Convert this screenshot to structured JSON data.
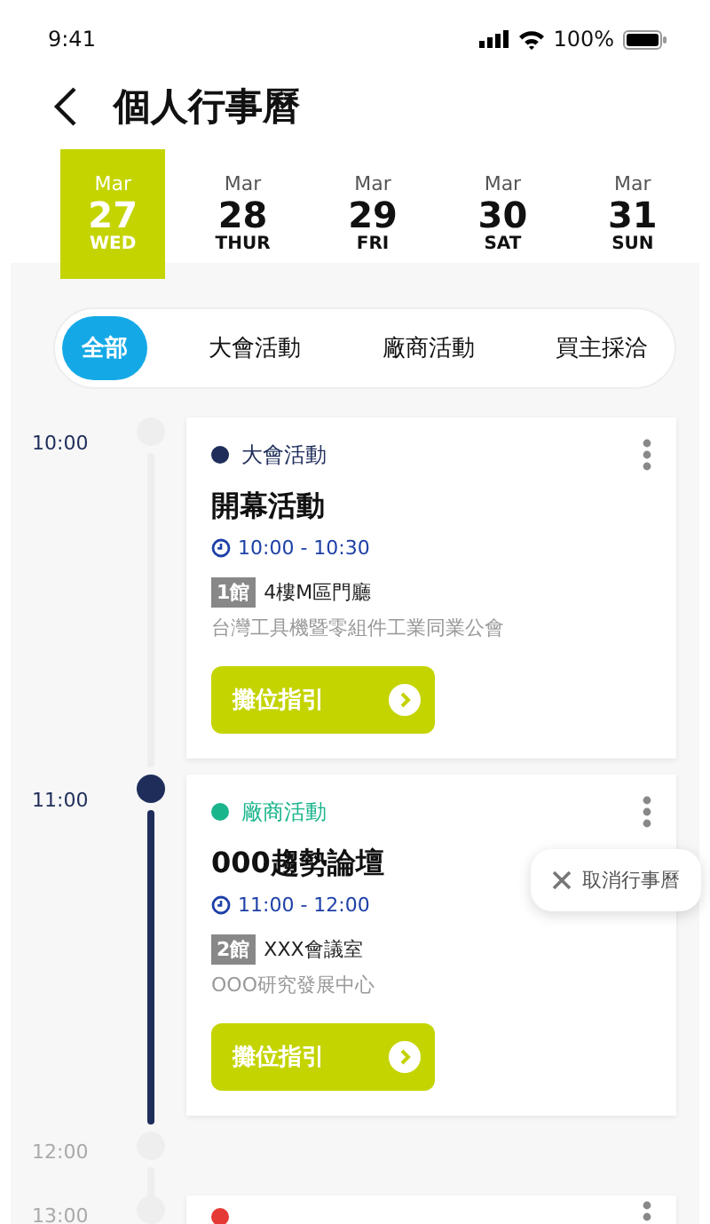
{
  "status_bar": {
    "time": "9:41",
    "battery": "100%"
  },
  "header": {
    "title": "個人行事曆"
  },
  "dates": [
    {
      "month": "Mar",
      "day": "27",
      "weekday": "WED",
      "selected": true
    },
    {
      "month": "Mar",
      "day": "28",
      "weekday": "THUR",
      "selected": false
    },
    {
      "month": "Mar",
      "day": "29",
      "weekday": "FRI",
      "selected": false
    },
    {
      "month": "Mar",
      "day": "30",
      "weekday": "SAT",
      "selected": false
    },
    {
      "month": "Mar",
      "day": "31",
      "weekday": "SUN",
      "selected": false
    }
  ],
  "filters": [
    {
      "label": "全部",
      "selected": true
    },
    {
      "label": "大會活動",
      "selected": false
    },
    {
      "label": "廠商活動",
      "selected": false
    },
    {
      "label": "買主採洽",
      "selected": false
    }
  ],
  "timeline": [
    {
      "time": "10:00",
      "active": false,
      "event": {
        "category": "大會活動",
        "color": "#1e2d5a",
        "title": "開幕活動",
        "time_range": "10:00 - 10:30",
        "hall": "1館",
        "location": "4樓M區門廳",
        "organizer": "台灣工具機暨零組件工業同業公會",
        "button": "攤位指引"
      }
    },
    {
      "time": "11:00",
      "active": true,
      "event": {
        "category": "廠商活動",
        "color": "#1bb58c",
        "title": "000趨勢論壇",
        "time_range": "11:00 - 12:00",
        "hall": "2館",
        "location": "XXX會議室",
        "organizer": "OOO研究發展中心",
        "button": "攤位指引",
        "menu": {
          "label": "取消行事曆"
        }
      }
    },
    {
      "time": "12:00",
      "active": false
    },
    {
      "time": "13:00",
      "active": false,
      "event": {
        "color": "#e53935"
      }
    }
  ]
}
